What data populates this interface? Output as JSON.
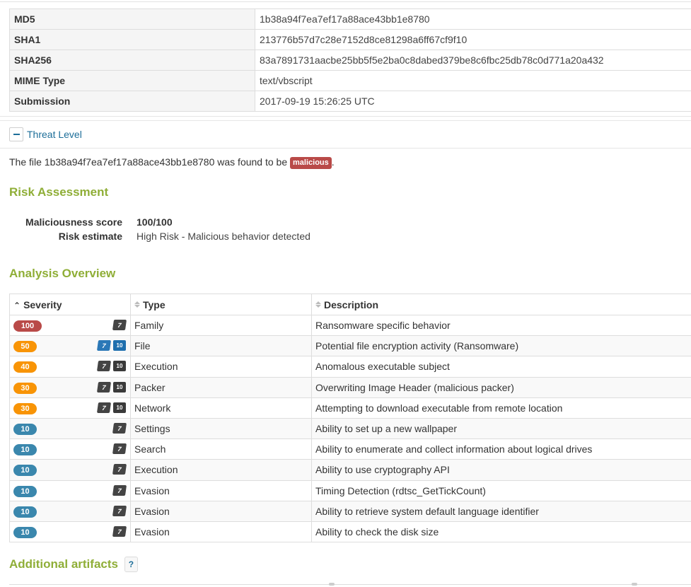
{
  "hashes": {
    "rows": [
      {
        "key": "MD5",
        "value": "1b38a94f7ea7ef17a88ace43bb1e8780"
      },
      {
        "key": "SHA1",
        "value": "213776b57d7c28e7152d8ce81298a6ff67cf9f10"
      },
      {
        "key": "SHA256",
        "value": "83a7891731aacbe25bb5f5e2ba0c8dabed379be8c6fbc25db78c0d771a20a432"
      },
      {
        "key": "MIME Type",
        "value": "text/vbscript"
      },
      {
        "key": "Submission",
        "value": "2017-09-19 15:26:25 UTC"
      }
    ]
  },
  "threat": {
    "title": "Threat Level",
    "collapse_icon": "minus-icon",
    "verdict_prefix": "The file 1b38a94f7ea7ef17a88ace43bb1e8780 was found to be",
    "verdict_badge": "malicious",
    "verdict_suffix": "."
  },
  "risk": {
    "heading": "Risk Assessment",
    "score_label": "Maliciousness score",
    "score_value": "100/100",
    "estimate_label": "Risk estimate",
    "estimate_value": "High Risk - Malicious behavior detected"
  },
  "analysis": {
    "heading": "Analysis Overview",
    "columns": {
      "severity": "Severity",
      "type": "Type",
      "description": "Description"
    },
    "rows": [
      {
        "severity": "100",
        "color": "#b94a48",
        "os": [
          "windows-7-icon"
        ],
        "type": "Family",
        "description": "Ransomware specific behavior"
      },
      {
        "severity": "50",
        "color": "#f89406",
        "os": [
          "windows-7-icon",
          "windows-10-icon"
        ],
        "type": "File",
        "description": "Potential file encryption activity (Ransomware)"
      },
      {
        "severity": "40",
        "color": "#f89406",
        "os": [
          "windows-7-icon",
          "windows-10-icon"
        ],
        "type": "Execution",
        "description": "Anomalous executable subject"
      },
      {
        "severity": "30",
        "color": "#f89406",
        "os": [
          "windows-7-icon",
          "windows-10-icon"
        ],
        "type": "Packer",
        "description": "Overwriting Image Header (malicious packer)"
      },
      {
        "severity": "30",
        "color": "#f89406",
        "os": [
          "windows-7-icon",
          "windows-10-icon"
        ],
        "type": "Network",
        "description": "Attempting to download executable from remote location"
      },
      {
        "severity": "10",
        "color": "#3a87ad",
        "os": [
          "windows-7-icon"
        ],
        "type": "Settings",
        "description": "Ability to set up a new wallpaper"
      },
      {
        "severity": "10",
        "color": "#3a87ad",
        "os": [
          "windows-7-icon"
        ],
        "type": "Search",
        "description": "Ability to enumerate and collect information about logical drives"
      },
      {
        "severity": "10",
        "color": "#3a87ad",
        "os": [
          "windows-7-icon"
        ],
        "type": "Execution",
        "description": "Ability to use cryptography API"
      },
      {
        "severity": "10",
        "color": "#3a87ad",
        "os": [
          "windows-7-icon"
        ],
        "type": "Evasion",
        "description": "Timing Detection (rdtsc_GetTickCount)"
      },
      {
        "severity": "10",
        "color": "#3a87ad",
        "os": [
          "windows-7-icon"
        ],
        "type": "Evasion",
        "description": "Ability to retrieve system default language identifier"
      },
      {
        "severity": "10",
        "color": "#3a87ad",
        "os": [
          "windows-7-icon"
        ],
        "type": "Evasion",
        "description": "Ability to check the disk size"
      }
    ],
    "os_labels": {
      "w7": "7",
      "w10": "10"
    }
  },
  "artifacts": {
    "heading": "Additional artifacts",
    "help_label": "?"
  },
  "colors": {
    "accent_green": "#8fae37",
    "link_blue": "#1d6e99",
    "malicious": "#b94a48",
    "warning": "#f89406",
    "info": "#3a87ad"
  }
}
